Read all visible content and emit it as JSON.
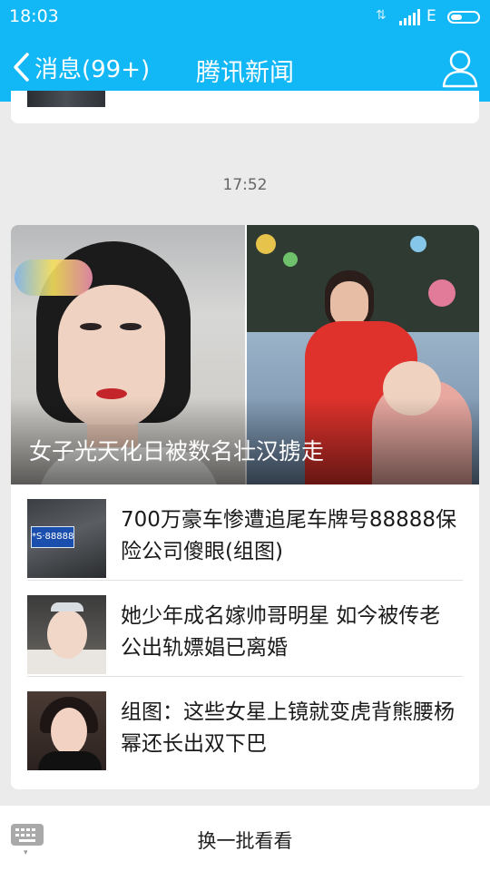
{
  "status_bar": {
    "time": "18:03",
    "network_type": "E",
    "icons": [
      "data-arrows-icon",
      "signal-icon",
      "battery-icon"
    ]
  },
  "header": {
    "back_label": "消息(99+)",
    "title": "腾讯新闻",
    "icons": [
      "back-chevron-icon",
      "profile-icon"
    ],
    "bg_color": "#12b7f5"
  },
  "timestamp": "17:52",
  "news": {
    "hero_caption": "女子光天化日被数名壮汉掳走",
    "items": [
      {
        "title": "700万豪车惨遭追尾车牌号88888保险公司傻眼(组图)",
        "thumb_text": "*S·88888"
      },
      {
        "title": "她少年成名嫁帅哥明星 如今被传老公出轨嫖娼已离婚"
      },
      {
        "title": "组图：这些女星上镜就变虎背熊腰杨幂还长出双下巴"
      }
    ]
  },
  "bottom": {
    "refresh_label": "换一批看看",
    "icons": [
      "keyboard-icon"
    ]
  }
}
